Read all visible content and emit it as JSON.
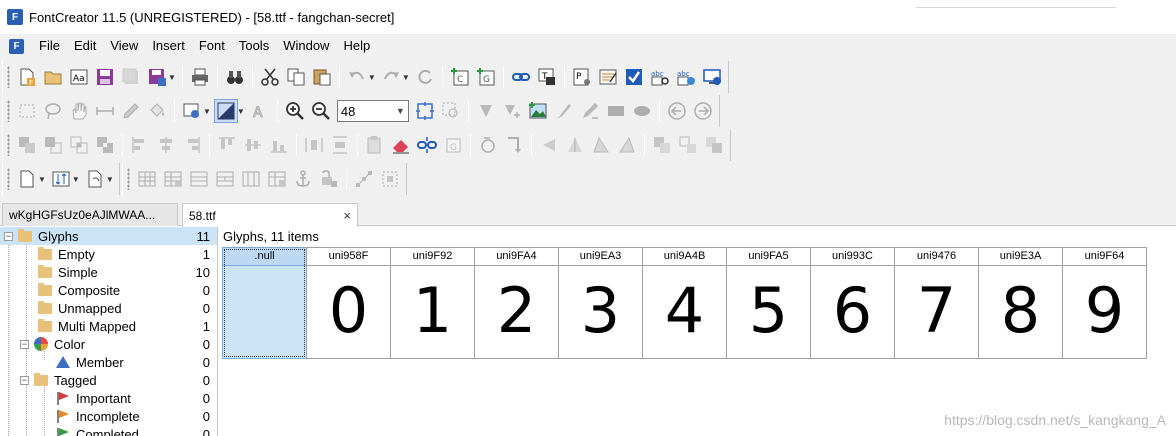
{
  "window": {
    "title": "FontCreator 11.5 (UNREGISTERED) - [58.ttf - fangchan-secret]",
    "app_icon": "F"
  },
  "menu": [
    "File",
    "Edit",
    "View",
    "Insert",
    "Font",
    "Tools",
    "Window",
    "Help"
  ],
  "toolbar": {
    "zoom_value": "48"
  },
  "tabs": [
    {
      "label": "wKgHGFsUz0eAJlMWAA...",
      "active": false
    },
    {
      "label": "58.ttf",
      "active": true,
      "close": "×"
    }
  ],
  "tree": {
    "root": {
      "label": "Glyphs",
      "count": "11",
      "expander": "−"
    },
    "items": [
      {
        "label": "Empty",
        "count": "1"
      },
      {
        "label": "Simple",
        "count": "10"
      },
      {
        "label": "Composite",
        "count": "0"
      },
      {
        "label": "Unmapped",
        "count": "0"
      },
      {
        "label": "Multi Mapped",
        "count": "1"
      },
      {
        "label": "Color",
        "count": "0",
        "expander": "−"
      },
      {
        "label": "Member",
        "count": "0"
      },
      {
        "label": "Tagged",
        "count": "0",
        "expander": "−"
      },
      {
        "label": "Important",
        "count": "0"
      },
      {
        "label": "Incomplete",
        "count": "0"
      },
      {
        "label": "Completed",
        "count": "0"
      }
    ]
  },
  "glyph_list": {
    "header": "Glyphs, 11 items",
    "glyphs": [
      {
        "name": ".null",
        "char": ""
      },
      {
        "name": "uni958F",
        "char": "0"
      },
      {
        "name": "uni9F92",
        "char": "1"
      },
      {
        "name": "uni9FA4",
        "char": "2"
      },
      {
        "name": "uni9EA3",
        "char": "3"
      },
      {
        "name": "uni9A4B",
        "char": "4"
      },
      {
        "name": "uni9FA5",
        "char": "5"
      },
      {
        "name": "uni993C",
        "char": "6"
      },
      {
        "name": "uni9476",
        "char": "7"
      },
      {
        "name": "uni9E3A",
        "char": "8"
      },
      {
        "name": "uni9F64",
        "char": "9"
      }
    ]
  },
  "watermark": "https://blog.csdn.net/s_kangkang_A",
  "colors": {
    "selection": "#cce4f7",
    "folder": "#e8c27a",
    "toolbar_bg": "#f0f0f0"
  }
}
